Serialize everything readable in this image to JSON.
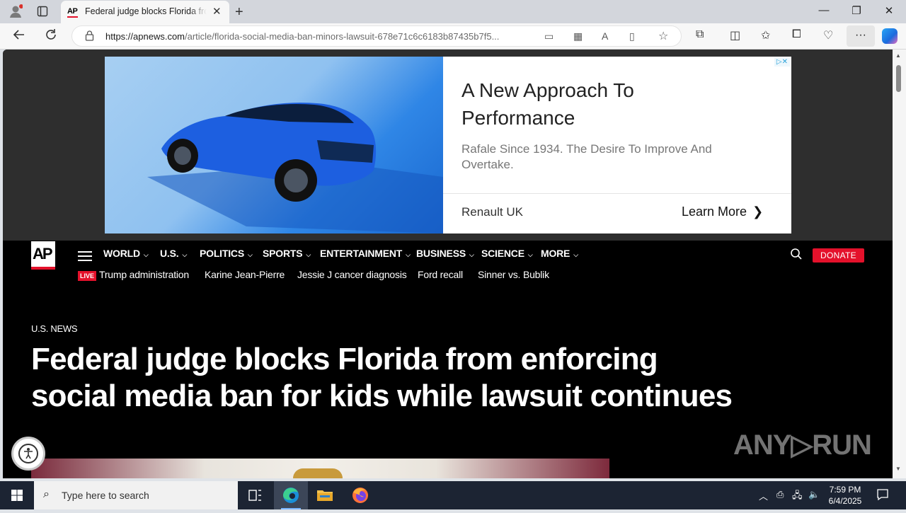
{
  "browser": {
    "tab_title": "Federal judge blocks Florida from enforcing social media ban",
    "tab_favicon": "AP",
    "url_host": "https://apnews.com",
    "url_path": "/article/florida-social-media-ban-minors-lawsuit-678e71c6c6183b87435b7f5..."
  },
  "ad": {
    "choices_label": "▷✕",
    "headline": "A New Approach To Performance",
    "body": "Rafale Since 1934. The Desire To Improve And Overtake.",
    "brand": "Renault UK",
    "cta": "Learn More"
  },
  "nav": {
    "logo": "AP",
    "items": [
      {
        "label": "WORLD"
      },
      {
        "label": "U.S."
      },
      {
        "label": "POLITICS"
      },
      {
        "label": "SPORTS"
      },
      {
        "label": "ENTERTAINMENT"
      },
      {
        "label": "BUSINESS"
      },
      {
        "label": "SCIENCE"
      },
      {
        "label": "MORE"
      }
    ],
    "live_badge": "LIVE",
    "trending": [
      {
        "label": "Trump administration"
      },
      {
        "label": "Karine Jean-Pierre"
      },
      {
        "label": "Jessie J cancer diagnosis"
      },
      {
        "label": "Ford recall"
      },
      {
        "label": "Sinner vs. Bublik"
      }
    ],
    "donate": "DONATE"
  },
  "article": {
    "section": "U.S. NEWS",
    "headline": "Federal judge blocks Florida from enforcing social media ban for kids while lawsuit continues"
  },
  "watermark": "ANY▷RUN",
  "taskbar": {
    "search_placeholder": "Type here to search",
    "time": "7:59 PM",
    "date": "6/4/2025"
  },
  "icons": [
    "profile-icon",
    "tab-actions-icon",
    "close-tab-icon",
    "new-tab-icon",
    "back-icon",
    "refresh-icon",
    "lock-icon",
    "reader-icon",
    "apps-icon",
    "read-aloud-icon",
    "immersive-reader-icon",
    "favorite-star-icon",
    "extensions-icon",
    "split-screen-icon",
    "favorites-icon",
    "collections-icon",
    "browser-essentials-icon",
    "settings-more-icon",
    "copilot-icon",
    "search-icon",
    "accessibility-icon",
    "windows-start-icon",
    "task-view-icon",
    "edge-icon",
    "file-explorer-icon",
    "firefox-icon",
    "notification-icon"
  ]
}
